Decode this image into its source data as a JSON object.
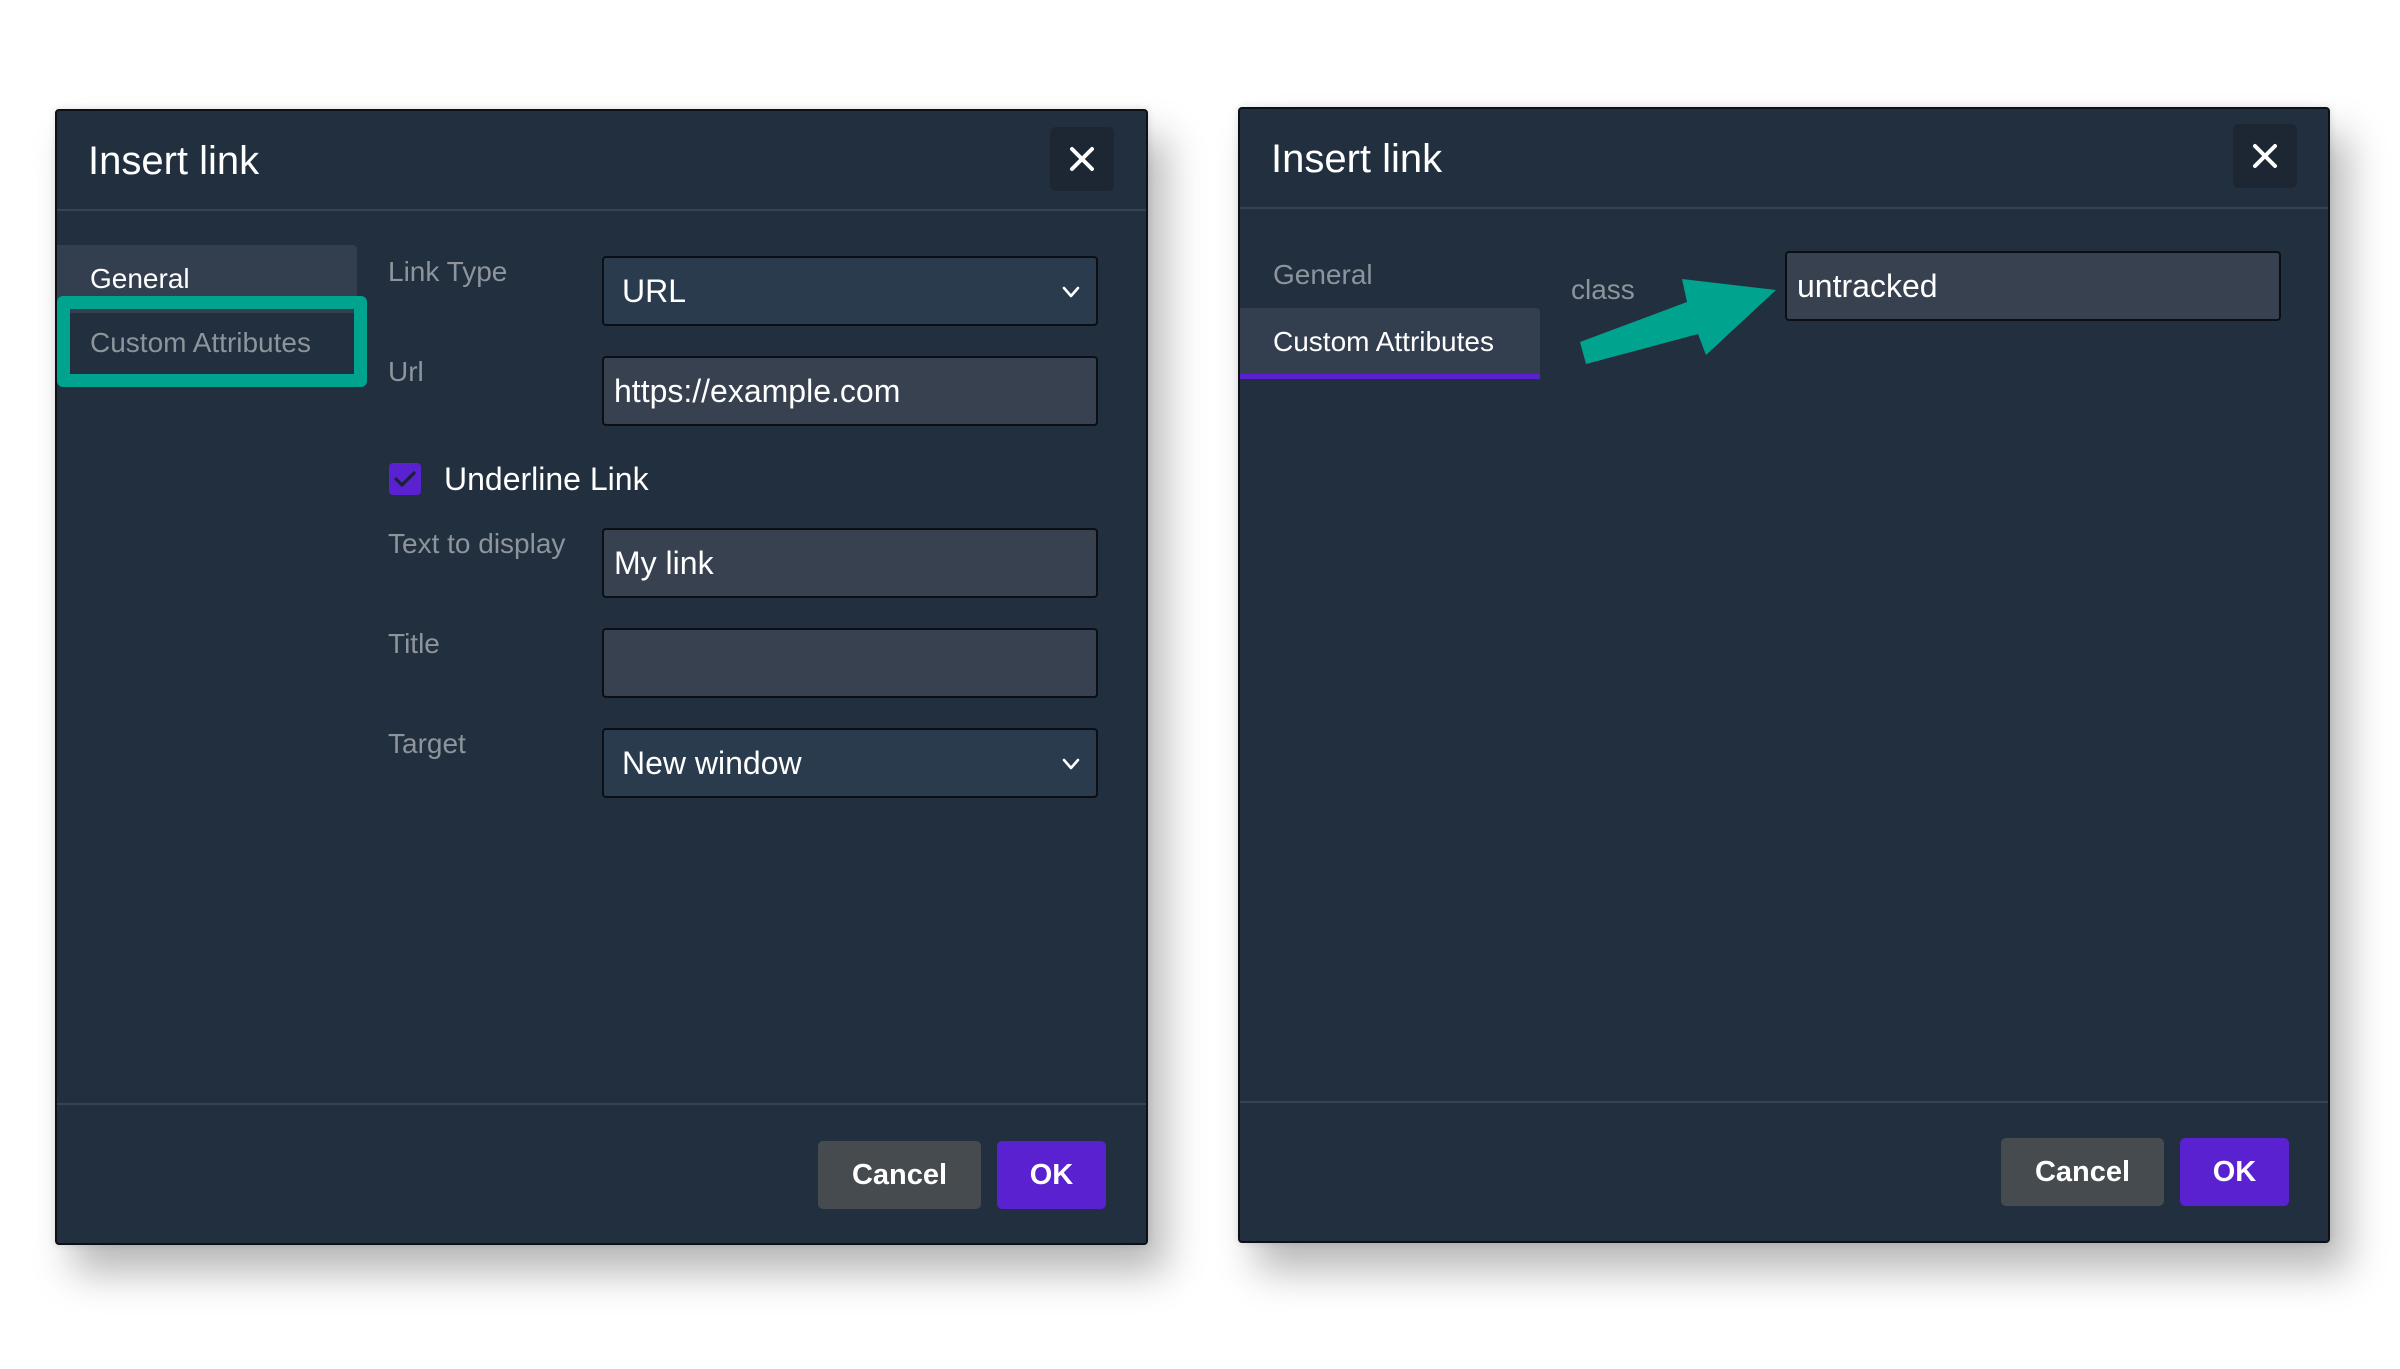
{
  "accent_colors": {
    "annotation": "#00a38e",
    "primary": "#5a21d0",
    "dialog_bg": "#222f3e"
  },
  "left_dialog": {
    "title": "Insert link",
    "close_icon": "close-icon",
    "tabs": [
      {
        "label": "General",
        "active": true
      },
      {
        "label": "Custom Attributes",
        "active": false,
        "highlighted": true
      }
    ],
    "fields": {
      "link_type": {
        "label": "Link Type",
        "value": "URL"
      },
      "url": {
        "label": "Url",
        "value": "https://example.com"
      },
      "underline": {
        "label": "Underline Link",
        "checked": true
      },
      "text_to_display": {
        "label": "Text to display",
        "value": "My link"
      },
      "title": {
        "label": "Title",
        "value": ""
      },
      "target": {
        "label": "Target",
        "value": "New window"
      }
    },
    "buttons": {
      "cancel": "Cancel",
      "ok": "OK"
    }
  },
  "right_dialog": {
    "title": "Insert link",
    "close_icon": "close-icon",
    "tabs": [
      {
        "label": "General",
        "active": false
      },
      {
        "label": "Custom Attributes",
        "active": true
      }
    ],
    "fields": {
      "class": {
        "label": "class",
        "value": "untracked"
      }
    },
    "buttons": {
      "cancel": "Cancel",
      "ok": "OK"
    }
  }
}
